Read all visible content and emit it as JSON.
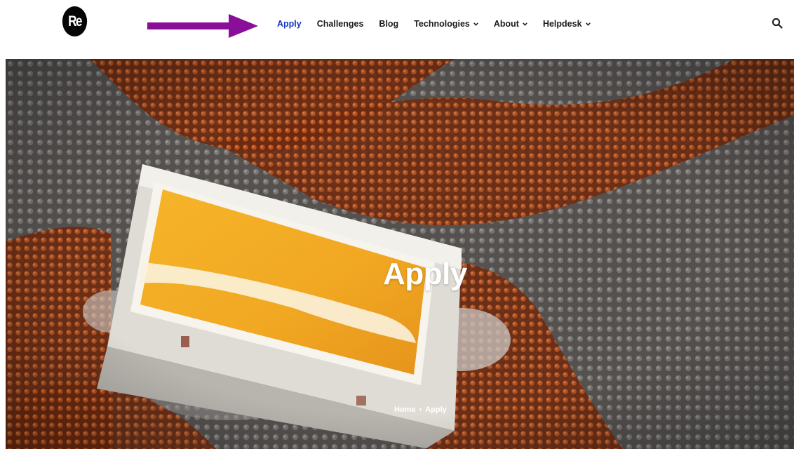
{
  "logo": {
    "text": "Re"
  },
  "nav": {
    "items": [
      {
        "label": "Apply",
        "active": true,
        "dropdown": false
      },
      {
        "label": "Challenges",
        "active": false,
        "dropdown": false
      },
      {
        "label": "Blog",
        "active": false,
        "dropdown": false
      },
      {
        "label": "Technologies",
        "active": false,
        "dropdown": true
      },
      {
        "label": "About",
        "active": false,
        "dropdown": true
      },
      {
        "label": "Helpdesk",
        "active": false,
        "dropdown": true
      }
    ]
  },
  "icons": {
    "search": "search-icon",
    "dropdown": "chevron-down-icon",
    "annotation": "arrow-right-icon"
  },
  "hero": {
    "title": "Apply",
    "breadcrumb": {
      "home": "Home",
      "separator": "›",
      "current": "Apply"
    }
  },
  "colors": {
    "active_nav": "#1437c8",
    "nav_text": "#1b1b1b",
    "annotation_arrow": "#8a0e99",
    "logo_bg": "#050505"
  }
}
